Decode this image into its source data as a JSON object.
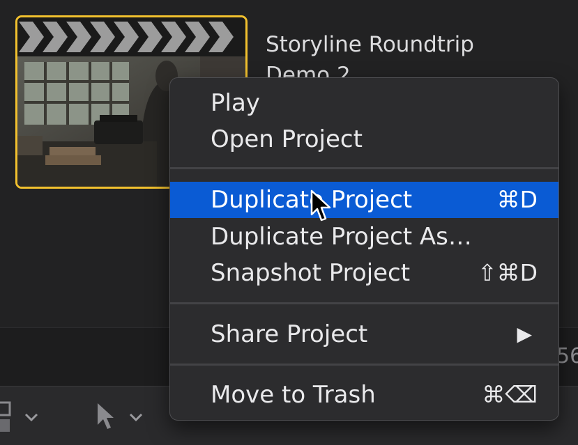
{
  "project": {
    "title": "Storyline Roundtrip Demo 2"
  },
  "background": {
    "timecode_partial": "56"
  },
  "context_menu": {
    "items": [
      {
        "label": "Play",
        "shortcut": ""
      },
      {
        "label": "Open Project",
        "shortcut": ""
      },
      {
        "label": "Duplicate Project",
        "shortcut": "⌘D",
        "highlighted": true
      },
      {
        "label": "Duplicate Project As…",
        "shortcut": ""
      },
      {
        "label": "Snapshot Project",
        "shortcut": "⇧⌘D"
      },
      {
        "label": "Share Project",
        "shortcut": "▶"
      },
      {
        "label": "Move to Trash",
        "shortcut": "⌘⌫"
      }
    ]
  },
  "colors": {
    "highlight": "#0a5bd4",
    "selection_border": "#f2c12e",
    "menu_bg": "#2c2c2e"
  },
  "icons": [
    "clapperboard-icon",
    "select-tool-icon",
    "chevron-down-icon",
    "clip-appearance-icon",
    "submenu-arrow-icon"
  ]
}
